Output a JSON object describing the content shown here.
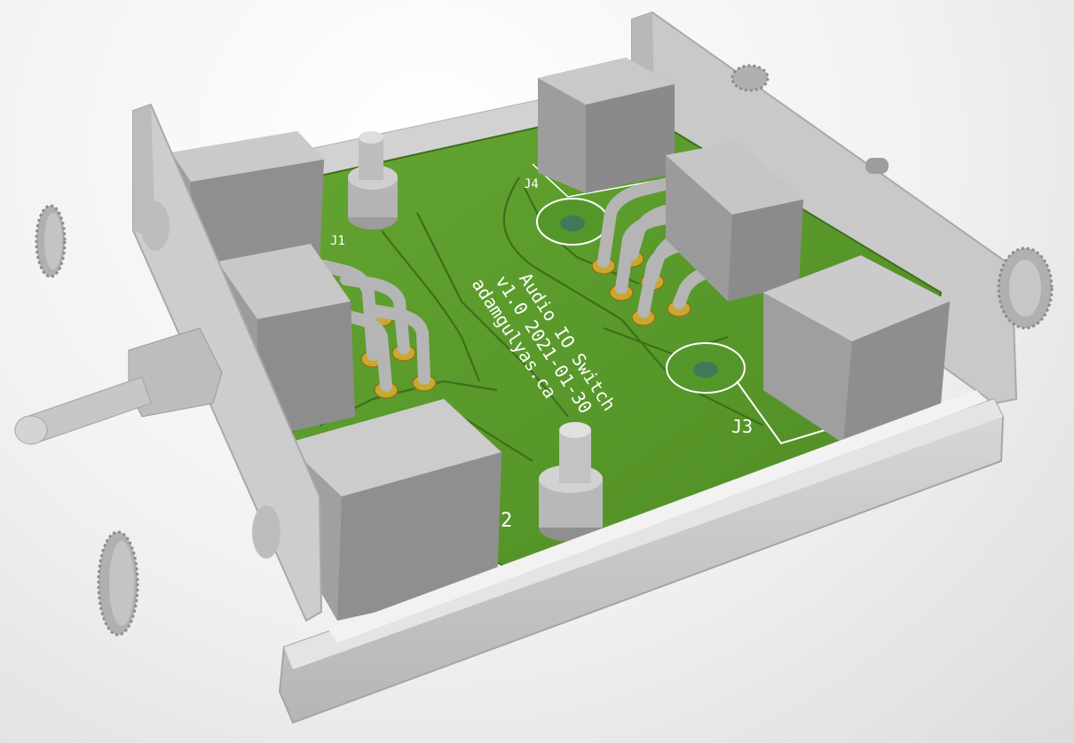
{
  "scene": {
    "board": {
      "title": "Audio IO Switch",
      "version_date": "v1.0  2021-01-30",
      "website": "adamgulyas.ca"
    },
    "refdes": {
      "j1": "J1",
      "j2": "2",
      "j3": "J3",
      "j4": "J4"
    }
  },
  "colors": {
    "pcb": "#5c9b2c",
    "pcb_dark": "#447a1f",
    "silkscreen": "#ffffff",
    "pad": "#c9a82e",
    "enclosure": "#c4c4c4",
    "connector": "#9a9a9a",
    "background": "#efefef"
  }
}
